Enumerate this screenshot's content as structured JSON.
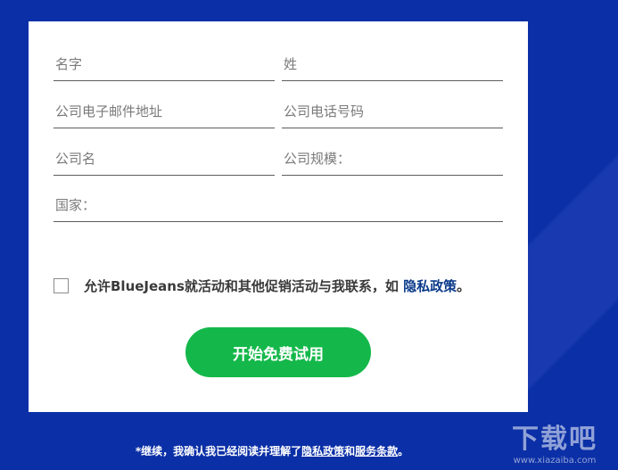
{
  "form": {
    "first_name_placeholder": "名字",
    "last_name_placeholder": "姓",
    "email_placeholder": "公司电子邮件地址",
    "phone_placeholder": "公司电话号码",
    "company_placeholder": "公司名",
    "company_size_placeholder": "公司规模：",
    "country_placeholder": "国家："
  },
  "consent": {
    "text": "允许BlueJeans就活动和其他促销活动与我联系，如 ",
    "link": "隐私政策",
    "suffix": "。"
  },
  "start_button_label": "开始免费试用",
  "footer": {
    "prefix": "*继续，我确认我已经阅读并理解了",
    "privacy_link": "隐私政策",
    "and": "和",
    "terms_link": "服务条款",
    "suffix": "。"
  },
  "watermark": {
    "main": "下载吧",
    "sub": "www.xiazaiba.com"
  },
  "colors": {
    "background": "#0b2fa6",
    "card": "#ffffff",
    "button": "#14b84a",
    "link": "#0b3a8a"
  }
}
